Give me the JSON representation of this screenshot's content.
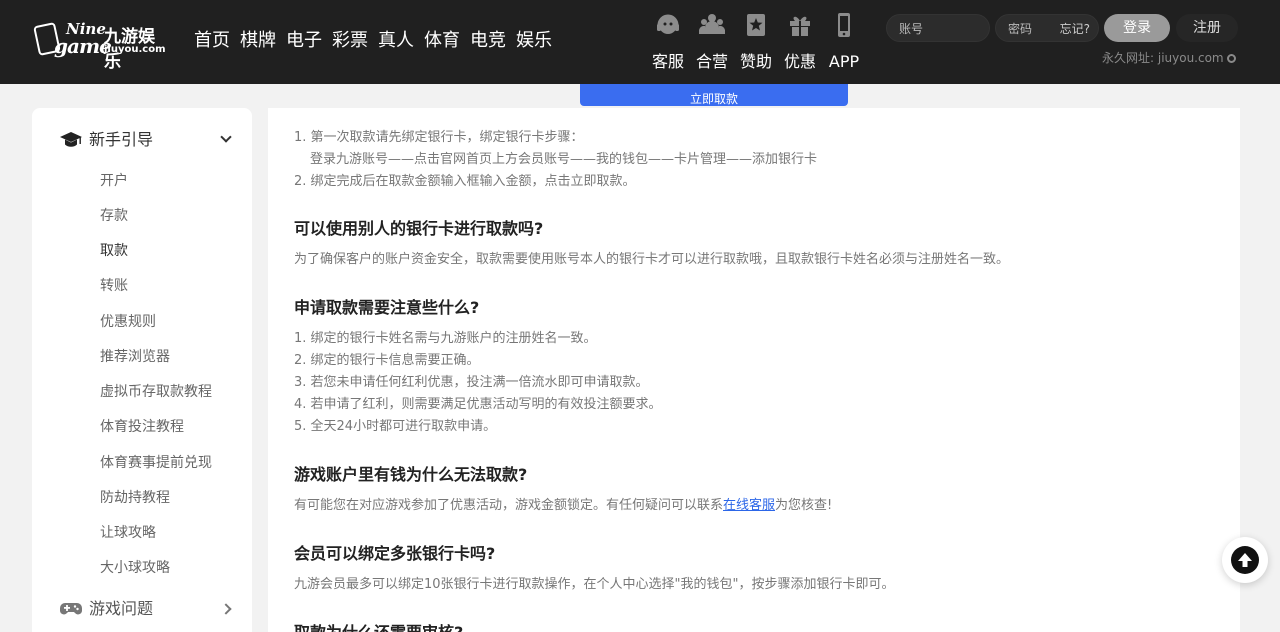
{
  "logo": {
    "nine": "Nine",
    "game": "game",
    "cn": "九游娱乐",
    "en": "jiuyou.com"
  },
  "nav": [
    "首页",
    "棋牌",
    "电子",
    "彩票",
    "真人",
    "体育",
    "电竞",
    "娱乐"
  ],
  "services": [
    "客服",
    "合营",
    "赞助",
    "优惠",
    "APP"
  ],
  "auth": {
    "account_placeholder": "账号",
    "password_placeholder": "密码",
    "forgot": "忘记?",
    "login": "登录",
    "register": "注册"
  },
  "permanent_url": "永久网址: jiuyou.com",
  "withdraw_button": "立即取款",
  "sidebar": {
    "group_guide": "新手引导",
    "items": [
      "开户",
      "存款",
      "取款",
      "转账",
      "优惠规则",
      "推荐浏览器",
      "虚拟币存取款教程",
      "体育投注教程",
      "体育赛事提前兑现",
      "防劫持教程",
      "让球攻略",
      "大小球攻略"
    ],
    "group_game": "游戏问题"
  },
  "content": {
    "steps": [
      "1. 第一次取款请先绑定银行卡，绑定银行卡步骤：",
      "登录九游账号——点击官网首页上方会员账号——我的钱包——卡片管理——添加银行卡",
      "2. 绑定完成后在取款金额输入框输入金额，点击立即取款。"
    ],
    "q1": "可以使用别人的银行卡进行取款吗?",
    "a1": "为了确保客户的账户资金安全，取款需要使用账号本人的银行卡才可以进行取款哦，且取款银行卡姓名必须与注册姓名一致。",
    "q2": "申请取款需要注意些什么?",
    "a2": [
      "1. 绑定的银行卡姓名需与九游账户的注册姓名一致。",
      "2. 绑定的银行卡信息需要正确。",
      "3. 若您未申请任何红利优惠，投注满一倍流水即可申请取款。",
      "4. 若申请了红利，则需要满足优惠活动写明的有效投注额要求。",
      "5. 全天24小时都可进行取款申请。"
    ],
    "q3": "游戏账户里有钱为什么无法取款?",
    "a3_pre": "有可能您在对应游戏参加了优惠活动，游戏金额锁定。有任何疑问可以联系",
    "a3_link": "在线客服",
    "a3_post": "为您核查!",
    "q4": "会员可以绑定多张银行卡吗?",
    "a4": "九游会员最多可以绑定10张银行卡进行取款操作，在个人中心选择\"我的钱包\"，按步骤添加银行卡即可。",
    "q5": "取款为什么还需要审核?"
  }
}
